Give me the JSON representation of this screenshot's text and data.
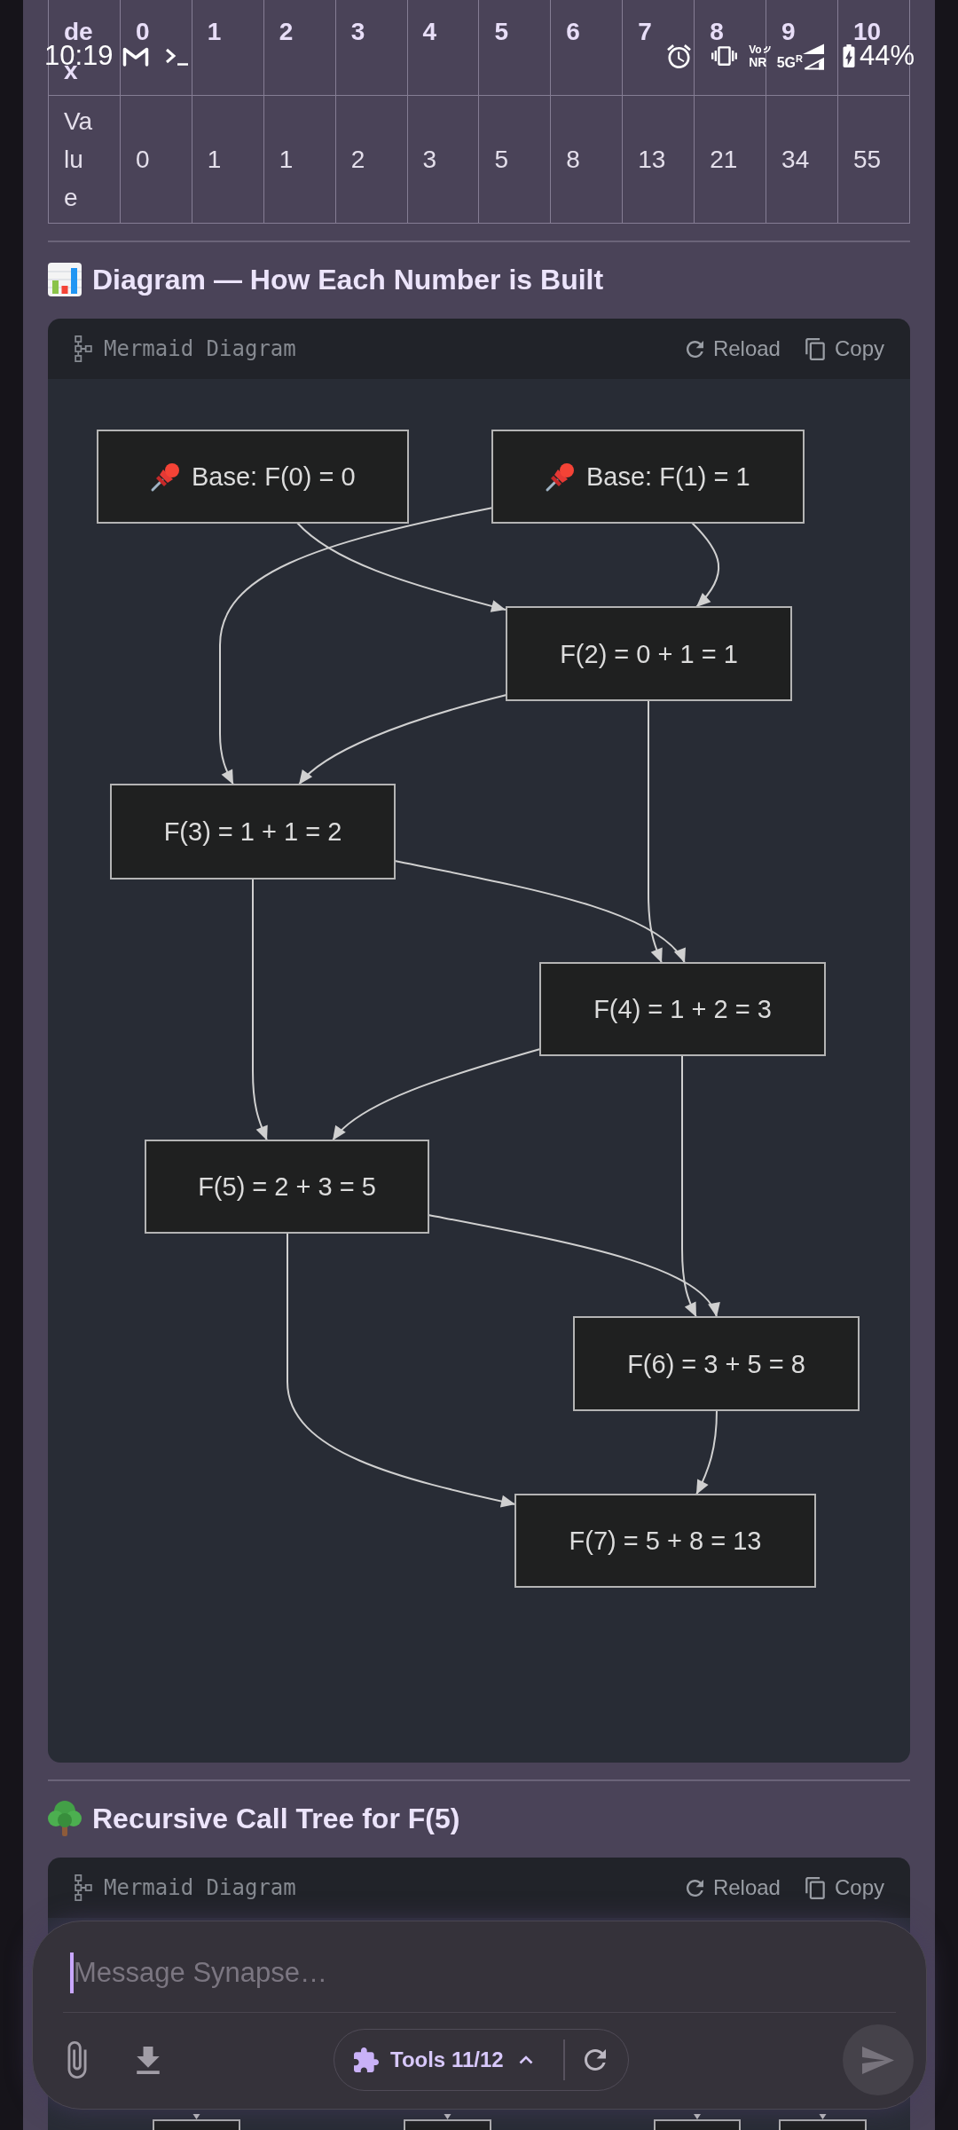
{
  "status_bar": {
    "time": "10:19",
    "voice_badge": {
      "top": "Vo",
      "bottom": "NR"
    },
    "network": "5G",
    "roaming": "R",
    "charging": true,
    "battery": "44%"
  },
  "table": {
    "header": [
      "dex",
      "0",
      "1",
      "2",
      "3",
      "4",
      "5",
      "6",
      "7",
      "8",
      "9",
      "10"
    ],
    "rows": [
      [
        "Value",
        "0",
        "1",
        "1",
        "2",
        "3",
        "5",
        "8",
        "13",
        "21",
        "34",
        "55"
      ]
    ]
  },
  "sections": [
    {
      "kind": "chart",
      "heading": "Diagram — How Each Number is Built",
      "card": {
        "label": "Mermaid Diagram",
        "actions": [
          {
            "kind": "reload",
            "label": "Reload"
          },
          {
            "kind": "copy",
            "label": "Copy"
          }
        ]
      },
      "diagram": {
        "nodes": [
          {
            "kind": "base",
            "label": "Base: F(0) = 0"
          },
          {
            "kind": "base",
            "label": "Base: F(1) = 1"
          },
          {
            "kind": "step",
            "label": "F(2) = 0 + 1 = 1"
          },
          {
            "kind": "step",
            "label": "F(3) = 1 + 1 = 2"
          },
          {
            "kind": "step",
            "label": "F(4) = 1 + 2 = 3"
          },
          {
            "kind": "step",
            "label": "F(5) = 2 + 3 = 5"
          },
          {
            "kind": "step",
            "label": "F(6) = 3 + 5 = 8"
          },
          {
            "kind": "step",
            "label": "F(7) = 5 + 8 = 13"
          }
        ]
      }
    },
    {
      "kind": "tree",
      "heading": "Recursive Call Tree for F(5)",
      "card": {
        "label": "Mermaid Diagram",
        "actions": [
          {
            "kind": "reload",
            "label": "Reload"
          },
          {
            "kind": "copy",
            "label": "Copy"
          }
        ]
      },
      "diagram": {
        "nodes": [
          {
            "kind": "clipped"
          },
          {
            "kind": "clipped"
          },
          {
            "kind": "clipped"
          },
          {
            "kind": "clipped"
          }
        ]
      }
    }
  ],
  "composer": {
    "placeholder": "Message Synapse…",
    "focused": true,
    "tools": {
      "label": "Tools 11/12",
      "expanded": false
    },
    "send_enabled": false
  }
}
